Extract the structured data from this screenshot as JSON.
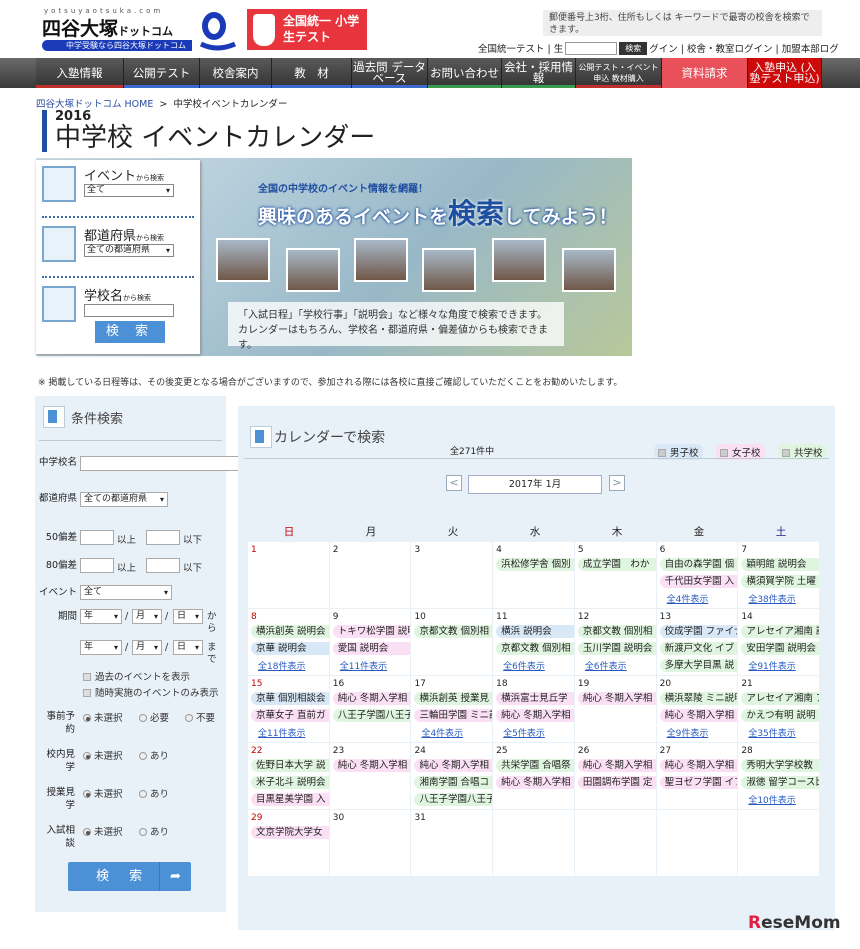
{
  "header": {
    "logo_url_text": "yotsuyaotsuka.com",
    "logo_name": "四谷大塚",
    "logo_name_small": "ドットコム",
    "logo_tagline": "中学受験なら四谷大塚ドットコム",
    "promo_banner": "全国統一 小学生テスト",
    "search_note": "郵便番号上3桁、住所もしくは キーワードで最寄の校舎を検索できます。",
    "link_test": "全国統一テスト | 生",
    "search_button": "検索",
    "link_logins": "グイン | 校舎・教室ログイン | 加盟本部ログ"
  },
  "nav": [
    {
      "label": "入塾情報",
      "color": "#c0302a"
    },
    {
      "label": "公開テスト",
      "color": "#3a6ad0"
    },
    {
      "label": "校舎案内",
      "color": "#3a6ad0"
    },
    {
      "label": "教　材",
      "color": "#3a6ad0"
    },
    {
      "label": "過去問 データベース",
      "color": "#3a6ad0"
    },
    {
      "label": "お問い合わせ",
      "color": "#3a9a50"
    },
    {
      "label": "会社・採用情報",
      "color": "#3a9a50"
    },
    {
      "label": "公開テスト・イベント申込 教材購入",
      "color": "#c0302a"
    },
    {
      "label": "資料請求",
      "color": "#e8505a"
    },
    {
      "label": "入塾申込 (入塾テスト申込)",
      "color": "#cc0a0a"
    }
  ],
  "breadcrumb": {
    "home": "四谷大塚ドットコム HOME",
    "sep": ">",
    "current": "中学校イベントカレンダー"
  },
  "title": {
    "year": "2016",
    "text": "中学校 イベントカレンダー"
  },
  "hero": {
    "event_label": "イベント",
    "event_suffix": "から検索",
    "event_value": "全て",
    "pref_label": "都道府県",
    "pref_suffix": "から検索",
    "pref_value": "全ての都道府県",
    "school_label": "学校名",
    "school_suffix": "から検索",
    "search_button": "検 索",
    "tagline": "全国の中学校のイベント情報を網羅！",
    "headline_a": "興味のあるイベントを",
    "headline_b": "検索",
    "headline_c": "してみよう！",
    "desc1": "「入試日程」「学校行事」「説明会」など様々な角度で検索できます。",
    "desc2": "カレンダーはもちろん、学校名・都道府県・偏差値からも検索できます。"
  },
  "notice": "※ 掲載している日程等は、その後変更となる場合がございますので、参加される際には各校に直接ご確認していただくことをお勧めいたします。",
  "sidebar": {
    "title": "条件検索",
    "school_name": "中学校名",
    "prefecture": "都道府県",
    "prefecture_value": "全ての都道府県",
    "dev50": "50偏差",
    "dev80": "80偏差",
    "above": "以上",
    "below": "以下",
    "event": "イベント",
    "event_value": "全て",
    "period": "期間",
    "year": "年",
    "month": "月",
    "day": "日",
    "from": "から",
    "to": "まで",
    "show_past": "過去のイベントを表示",
    "show_anytime": "随時実施のイベントのみ表示",
    "reservation": "事前予約",
    "visit": "校内見学",
    "class_visit": "授業見学",
    "consult": "入試相談",
    "unselected": "未選択",
    "required": "必要",
    "not_required": "不要",
    "yes": "あり",
    "search_button": "検 索"
  },
  "calendar": {
    "title": "カレンダーで検索",
    "count": "全271件中",
    "legend": [
      {
        "label": "男子校",
        "color": "#d8e8f6"
      },
      {
        "label": "女子校",
        "color": "#fbe0f5"
      },
      {
        "label": "共学校",
        "color": "#dff5df"
      }
    ],
    "prev": "<",
    "next": ">",
    "month": "2017年 1月",
    "weekdays": [
      "日",
      "月",
      "火",
      "水",
      "木",
      "金",
      "土"
    ],
    "colors": {
      "boys": "#d8e8f6",
      "girls": "#fbe0f5",
      "coed": "#dff5df",
      "sunday": "#c00000",
      "saturday": "#1a1a80",
      "link": "#2a5cc0"
    },
    "weeks": [
      [
        {
          "n": "1",
          "ev": []
        },
        {
          "n": "2",
          "ev": []
        },
        {
          "n": "3",
          "ev": []
        },
        {
          "n": "4",
          "ev": [
            [
              "浜松修学舎 個別",
              "coed"
            ]
          ]
        },
        {
          "n": "5",
          "ev": [
            [
              "成立学園　わか",
              "coed"
            ]
          ]
        },
        {
          "n": "6",
          "ev": [
            [
              "自由の森学園 個",
              "coed"
            ],
            [
              "千代田女学園 入",
              "girls"
            ]
          ],
          "more": "全4件表示"
        },
        {
          "n": "7",
          "ev": [
            [
              "穎明館 説明会",
              "coed"
            ],
            [
              "横須賀学院 土曜",
              "coed"
            ]
          ],
          "more": "全38件表示"
        }
      ],
      [
        {
          "n": "8",
          "ev": [
            [
              "横浜創英 説明会",
              "coed"
            ],
            [
              "京華 説明会",
              "boys"
            ]
          ],
          "more": "全18件表示"
        },
        {
          "n": "9",
          "ev": [
            [
              "トキワ松学園 説明",
              "girls"
            ],
            [
              "愛国 説明会",
              "girls"
            ]
          ],
          "more": "全11件表示"
        },
        {
          "n": "10",
          "ev": [
            [
              "京都文教 個別相",
              "coed"
            ]
          ]
        },
        {
          "n": "11",
          "ev": [
            [
              "横浜 説明会",
              "boys"
            ],
            [
              "京都文教 個別相",
              "coed"
            ]
          ],
          "more": "全6件表示"
        },
        {
          "n": "12",
          "ev": [
            [
              "京都文教 個別相",
              "coed"
            ],
            [
              "玉川学園 説明会",
              "coed"
            ]
          ],
          "more": "全6件表示"
        },
        {
          "n": "13",
          "ev": [
            [
              "佼成学園 ファイナル",
              "boys"
            ],
            [
              "新渡戸文化 イブ",
              "coed"
            ],
            [
              "多摩大学目黒 説",
              "coed"
            ]
          ]
        },
        {
          "n": "14",
          "ev": [
            [
              "アレセイア湘南 説",
              "coed"
            ],
            [
              "安田学園 説明会",
              "coed"
            ]
          ],
          "more": "全91件表示"
        }
      ],
      [
        {
          "n": "15",
          "ev": [
            [
              "京華 個別相談会",
              "boys"
            ],
            [
              "京華女子 直前ガ",
              "girls"
            ]
          ],
          "more": "全11件表示"
        },
        {
          "n": "16",
          "ev": [
            [
              "純心 冬期入学相",
              "girls"
            ],
            [
              "八王子学園八王子",
              "coed"
            ]
          ]
        },
        {
          "n": "17",
          "ev": [
            [
              "横浜創英 授業見",
              "coed"
            ],
            [
              "三輪田学園 ミニ説",
              "girls"
            ]
          ],
          "more": "全4件表示"
        },
        {
          "n": "18",
          "ev": [
            [
              "横浜富士見丘学",
              "girls"
            ],
            [
              "純心 冬期入学相",
              "girls"
            ]
          ],
          "more": "全5件表示"
        },
        {
          "n": "19",
          "ev": [
            [
              "純心 冬期入学相",
              "girls"
            ]
          ]
        },
        {
          "n": "20",
          "ev": [
            [
              "横浜翠陵 ミニ説明",
              "coed"
            ],
            [
              "純心 冬期入学相",
              "girls"
            ]
          ],
          "more": "全9件表示"
        },
        {
          "n": "21",
          "ev": [
            [
              "アレセイア湘南 ア",
              "coed"
            ],
            [
              "かえつ有明 説明",
              "coed"
            ]
          ],
          "more": "全35件表示"
        }
      ],
      [
        {
          "n": "22",
          "ev": [
            [
              "佐野日本大学 説",
              "coed"
            ],
            [
              "米子北斗 説明会",
              "coed"
            ],
            [
              "目黒星美学園 入",
              "girls"
            ]
          ]
        },
        {
          "n": "23",
          "ev": [
            [
              "純心 冬期入学相",
              "girls"
            ]
          ]
        },
        {
          "n": "24",
          "ev": [
            [
              "純心 冬期入学相",
              "girls"
            ],
            [
              "湘南学園 合唱コ",
              "coed"
            ],
            [
              "八王子学園八王子",
              "coed"
            ]
          ]
        },
        {
          "n": "25",
          "ev": [
            [
              "共栄学園 合唱祭",
              "coed"
            ],
            [
              "純心 冬期入学相",
              "girls"
            ]
          ]
        },
        {
          "n": "26",
          "ev": [
            [
              "純心 冬期入学相",
              "girls"
            ],
            [
              "田園調布学園 定",
              "girls"
            ]
          ]
        },
        {
          "n": "27",
          "ev": [
            [
              "純心 冬期入学相",
              "girls"
            ],
            [
              "聖ヨゼフ学園 イブ",
              "girls"
            ]
          ]
        },
        {
          "n": "28",
          "ev": [
            [
              "秀明大学学校教",
              "coed"
            ],
            [
              "淑徳 留学コース比",
              "coed"
            ]
          ],
          "more": "全10件表示"
        }
      ],
      [
        {
          "n": "29",
          "ev": [
            [
              "文京学院大学女",
              "girls"
            ]
          ]
        },
        {
          "n": "30",
          "ev": []
        },
        {
          "n": "31",
          "ev": []
        },
        {
          "n": "",
          "ev": []
        },
        {
          "n": "",
          "ev": []
        },
        {
          "n": "",
          "ev": []
        },
        {
          "n": "",
          "ev": []
        }
      ]
    ]
  },
  "watermark": "ReseMom"
}
